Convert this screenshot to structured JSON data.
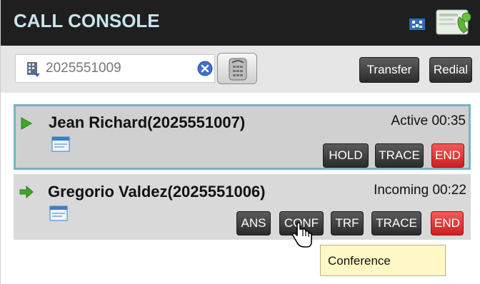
{
  "header": {
    "title": "CALL CONSOLE"
  },
  "toolbar": {
    "dial_value": "2025551009",
    "transfer_label": "Transfer",
    "redial_label": "Redial"
  },
  "calls": [
    {
      "name": "Jean Richard(2025551007)",
      "status": "Active 00:35",
      "buttons": [
        "HOLD",
        "TRACE",
        "END"
      ]
    },
    {
      "name": "Gregorio Valdez(2025551006)",
      "status": "Incoming 00:22",
      "buttons": [
        "ANS",
        "CONF",
        "TRF",
        "TRACE",
        "END"
      ]
    }
  ],
  "tooltip": {
    "text": "Conference"
  },
  "colors": {
    "header_bg": "#1f1f1f",
    "title_text": "#c7e6ee",
    "active_border": "#79b3c0",
    "end_button": "#e03a3a",
    "tooltip_bg": "#fff8c6"
  },
  "icons": {
    "header": [
      "network-status-icon",
      "agent-console-icon"
    ],
    "toolbar": [
      "directory-icon",
      "clear-icon",
      "phone-keypad-icon"
    ],
    "calls": [
      "play-icon",
      "arrow-icon",
      "contact-card-icon"
    ],
    "cursor": "hand-pointer-icon"
  }
}
